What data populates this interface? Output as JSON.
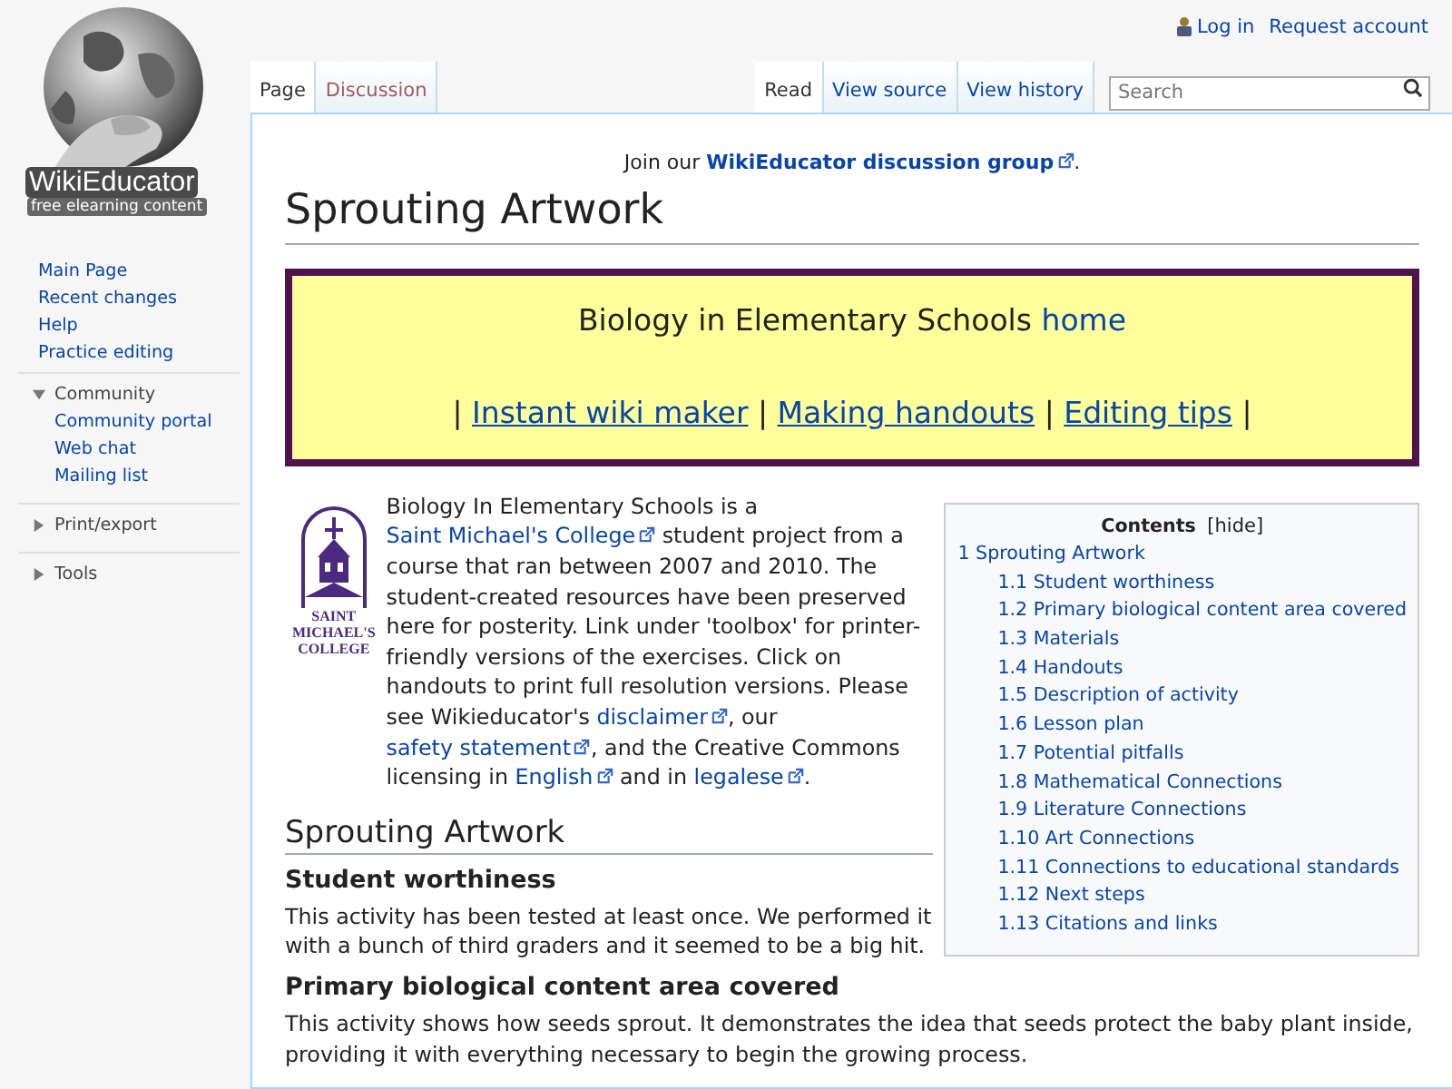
{
  "personal_tools": [
    {
      "label": "Log in",
      "kind": "login"
    },
    {
      "label": "Request account",
      "kind": "plain"
    }
  ],
  "left_tabs": [
    {
      "label": "Page",
      "selected": true,
      "new": false
    },
    {
      "label": "Discussion",
      "selected": false,
      "new": true
    }
  ],
  "right_tabs": [
    {
      "label": "Read",
      "selected": true
    },
    {
      "label": "View source",
      "selected": false
    },
    {
      "label": "View history",
      "selected": false
    }
  ],
  "search": {
    "placeholder": "Search"
  },
  "logo": {
    "name": "WikiEducator",
    "tagline": "free elearning content"
  },
  "sidebar": {
    "navigation": [
      "Main Page",
      "Recent changes",
      "Help",
      "Practice editing"
    ],
    "portals": [
      {
        "label": "Community",
        "expanded": true,
        "items": [
          "Community portal",
          "Web chat",
          "Mailing list"
        ]
      },
      {
        "label": "Print/export",
        "expanded": false
      },
      {
        "label": "Tools",
        "expanded": false
      }
    ]
  },
  "sitenotice": [
    {
      "kind": "text",
      "text": "Join our "
    },
    {
      "kind": "link",
      "text": "WikiEducator discussion group",
      "external": true
    },
    {
      "kind": "text",
      "text": "."
    }
  ],
  "title": "Sprouting Artwork",
  "banner": {
    "line_1": [
      {
        "kind": "text",
        "text": "Biology in Elementary Schools "
      },
      {
        "kind": "link",
        "text": "home",
        "external": false
      }
    ],
    "line_2": [
      {
        "kind": "text",
        "text": "| "
      },
      {
        "kind": "link",
        "text": "Instant wiki maker",
        "external": false
      },
      {
        "kind": "text",
        "text": " | "
      },
      {
        "kind": "link",
        "text": "Making handouts",
        "external": false
      },
      {
        "kind": "text",
        "text": " | "
      },
      {
        "kind": "link",
        "text": "Editing tips",
        "external": false
      },
      {
        "kind": "text",
        "text": " |"
      }
    ]
  },
  "college_logo": {
    "lines": [
      "SAINT",
      "MICHAEL'S",
      "COLLEGE"
    ]
  },
  "intro": [
    {
      "kind": "text",
      "text": "Biology In Elementary Schools is a "
    },
    {
      "kind": "link",
      "text": "Saint Michael's College",
      "external": true
    },
    {
      "kind": "text",
      "text": " student project from a course that ran between 2007 and 2010. The student-created resources have been preserved here for posterity. Link under 'toolbox' for printer-friendly versions of the exercises. Click on handouts to print full resolution versions. Please see Wikieducator's "
    },
    {
      "kind": "link",
      "text": "disclaimer",
      "external": true
    },
    {
      "kind": "text",
      "text": ", our "
    },
    {
      "kind": "link",
      "text": "safety statement",
      "external": true
    },
    {
      "kind": "text",
      "text": ", and the Creative Commons licensing in "
    },
    {
      "kind": "link",
      "text": "English",
      "external": true
    },
    {
      "kind": "text",
      "text": " and in "
    },
    {
      "kind": "link",
      "text": "legalese",
      "external": true
    },
    {
      "kind": "text",
      "text": "."
    }
  ],
  "toc": {
    "title": "Contents",
    "toggle": "[hide]",
    "items": [
      {
        "number": "1",
        "label": "Sprouting Artwork",
        "children": [
          {
            "number": "1.1",
            "label": "Student worthiness"
          },
          {
            "number": "1.2",
            "label": "Primary biological content area covered"
          },
          {
            "number": "1.3",
            "label": "Materials"
          },
          {
            "number": "1.4",
            "label": "Handouts"
          },
          {
            "number": "1.5",
            "label": "Description of activity"
          },
          {
            "number": "1.6",
            "label": "Lesson plan"
          },
          {
            "number": "1.7",
            "label": "Potential pitfalls"
          },
          {
            "number": "1.8",
            "label": "Mathematical Connections"
          },
          {
            "number": "1.9",
            "label": "Literature Connections"
          },
          {
            "number": "1.10",
            "label": "Art Connections"
          },
          {
            "number": "1.11",
            "label": "Connections to educational standards"
          },
          {
            "number": "1.12",
            "label": "Next steps"
          },
          {
            "number": "1.13",
            "label": "Citations and links"
          }
        ]
      }
    ]
  },
  "sections": [
    {
      "kind": "h2",
      "text": "Sprouting Artwork"
    },
    {
      "kind": "h3",
      "text": "Student worthiness"
    },
    {
      "kind": "p",
      "text": "This activity has been tested at least once. We performed it with a bunch of third graders and it seemed to be a big hit."
    },
    {
      "kind": "h3",
      "text": "Primary biological content area covered"
    },
    {
      "kind": "p",
      "text": "This activity shows how seeds sprout. It demonstrates the idea that seeds protect the baby plant inside, providing it with everything necessary to begin the growing process."
    }
  ]
}
